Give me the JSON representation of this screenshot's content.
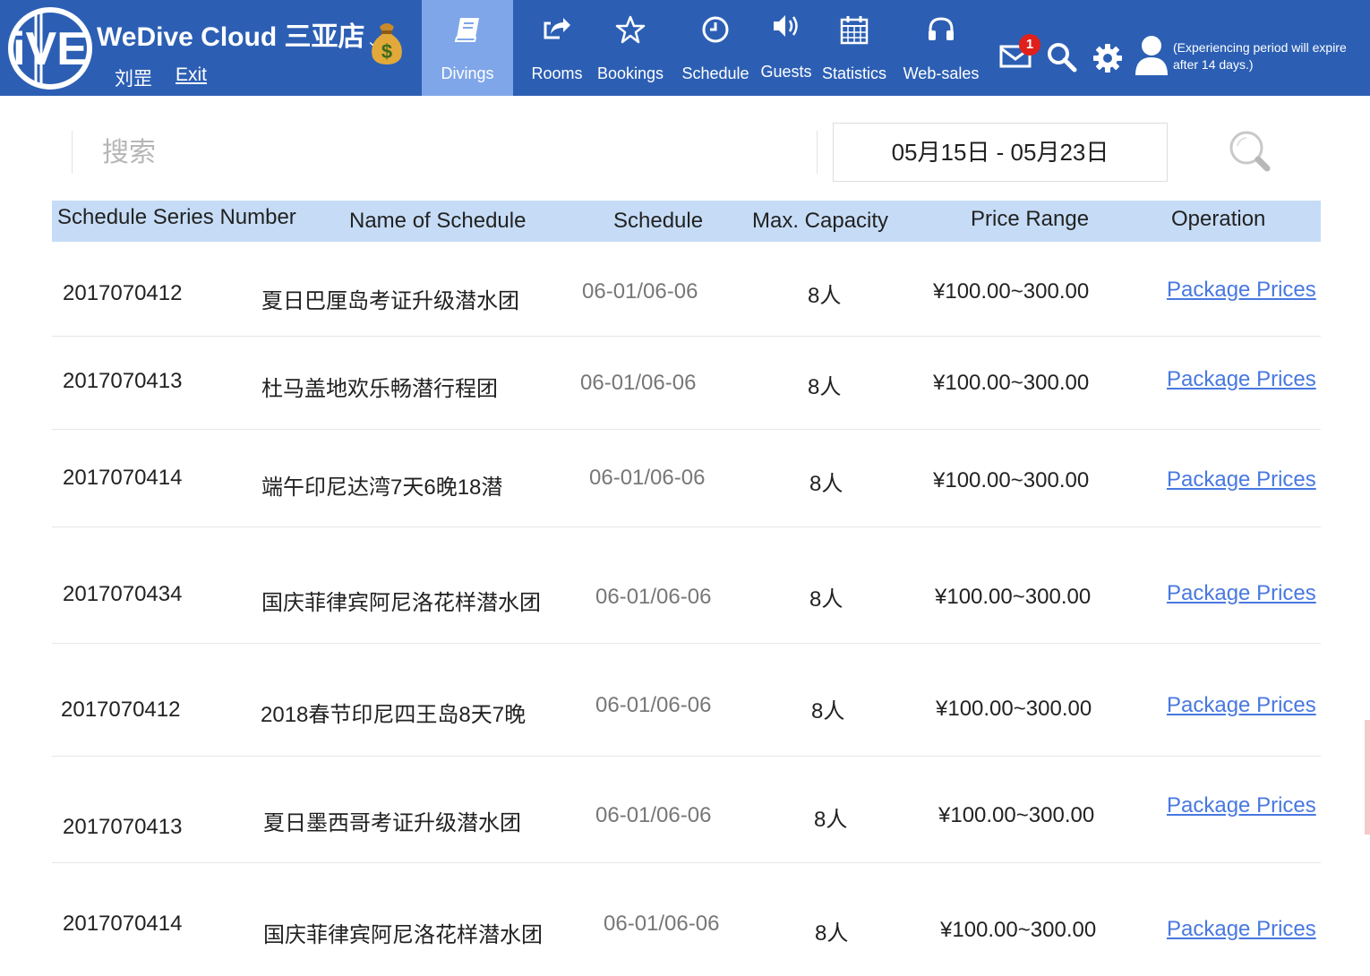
{
  "header": {
    "brand": "WeDive Cloud",
    "store": "三亚店",
    "user_name": "刘罡",
    "exit_label": "Exit",
    "nav": [
      {
        "label": "Divings",
        "icon": "book-icon",
        "active": true
      },
      {
        "label": "Rooms",
        "icon": "share-icon",
        "active": false
      },
      {
        "label": "Bookings",
        "icon": "star-icon",
        "active": false
      },
      {
        "label": "Schedule",
        "icon": "clock-icon",
        "active": false
      },
      {
        "label": "Guests",
        "icon": "speaker-icon",
        "active": false
      },
      {
        "label": "Statistics",
        "icon": "calendar-icon",
        "active": false
      },
      {
        "label": "Web-sales",
        "icon": "headphones-icon",
        "active": false
      }
    ],
    "mail_badge": "1",
    "expire_note": "(Experiencing period will expire after 14 days.)",
    "brand_color": "#2c5fb4",
    "active_color": "#7fa6e8"
  },
  "filters": {
    "search_placeholder": "搜索",
    "date_range": "05月15日 - 05月23日"
  },
  "table": {
    "columns": [
      "Schedule Series Number",
      "Name of Schedule",
      "Schedule",
      "Max. Capacity",
      "Price Range",
      "Operation"
    ],
    "rows": [
      {
        "number": "2017070412",
        "name": "夏日巴厘岛考证升级潜水团",
        "schedule": "06-01/06-06",
        "capacity": "8人",
        "price": "¥100.00~300.00",
        "operation": "Package Prices"
      },
      {
        "number": "2017070413",
        "name": "杜马盖地欢乐畅潜行程团",
        "schedule": "06-01/06-06",
        "capacity": "8人",
        "price": "¥100.00~300.00",
        "operation": "Package Prices"
      },
      {
        "number": "2017070414",
        "name": "端午印尼达湾7天6晚18潜",
        "schedule": "06-01/06-06",
        "capacity": "8人",
        "price": "¥100.00~300.00",
        "operation": "Package Prices"
      },
      {
        "number": "2017070434",
        "name": "国庆菲律宾阿尼洛花样潜水团",
        "schedule": "06-01/06-06",
        "capacity": "8人",
        "price": "¥100.00~300.00",
        "operation": "Package Prices"
      },
      {
        "number": "2017070412",
        "name": "2018春节印尼四王岛8天7晚",
        "schedule": "06-01/06-06",
        "capacity": "8人",
        "price": "¥100.00~300.00",
        "operation": "Package Prices"
      },
      {
        "number": "2017070413",
        "name": "夏日墨西哥考证升级潜水团",
        "schedule": "06-01/06-06",
        "capacity": "8人",
        "price": "¥100.00~300.00",
        "operation": "Package Prices"
      },
      {
        "number": "2017070414",
        "name": "国庆菲律宾阿尼洛花样潜水团",
        "schedule": "06-01/06-06",
        "capacity": "8人",
        "price": "¥100.00~300.00",
        "operation": "Package Prices"
      }
    ],
    "header_color": "#c6dcf6",
    "link_color": "#4878e0"
  }
}
